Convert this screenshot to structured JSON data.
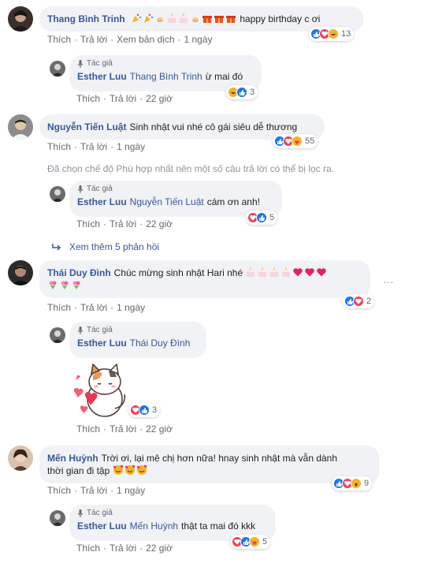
{
  "ui": {
    "like": "Thích",
    "reply": "Trả lời",
    "translate": "Xem bản dịch",
    "author_badge": "Tác giả",
    "sep": "·"
  },
  "c1": {
    "author": "Thang Bình Trinh",
    "text": "happy birthday c ơi",
    "time": "1 ngày",
    "reactions_count": "13",
    "reply": {
      "author": "Esther Luu",
      "mention": "Thang Bình Trinh",
      "text": "ừ mai đó",
      "time": "22 giờ",
      "reactions_count": "3"
    }
  },
  "c2": {
    "author": "Nguyễn Tiến Luật",
    "text": "Sinh nhật vui nhé cô gái siêu dễ thương",
    "time": "1 ngày",
    "reactions_count": "55",
    "filter_note": "Đã chọn chế độ Phù hợp nhất nên một số câu trả lời có thể bị lọc ra.",
    "reply": {
      "author": "Esther Luu",
      "mention": "Nguyễn Tiến Luật",
      "text": "cám ơn anh!",
      "time": "22 giờ",
      "reactions_count": "5"
    },
    "see_more": "Xem thêm 5 phản hồi"
  },
  "c3": {
    "author": "Thái Duy Đình",
    "text": "Chúc mừng sinh nhật Hari nhé",
    "time": "1 ngày",
    "reactions_count": "2",
    "more": "…",
    "reply": {
      "author": "Esther Luu",
      "mention": "Thái Duy Đình",
      "time": "22 giờ",
      "reactions_count": "3"
    }
  },
  "c4": {
    "author": "Mến Huỳnh",
    "text_line1": "Trời ơi, lại mê chị hơn nữa! hnay sinh nhật mà vẫn dành",
    "text_line2": "thời gian đi tập",
    "time": "1 ngày",
    "reactions_count": "9",
    "reply": {
      "author": "Esther Luu",
      "mention": "Mến Huỳnh",
      "text": "thật ta mai đó kkk",
      "time": "22 giờ",
      "reactions_count": "5"
    }
  }
}
